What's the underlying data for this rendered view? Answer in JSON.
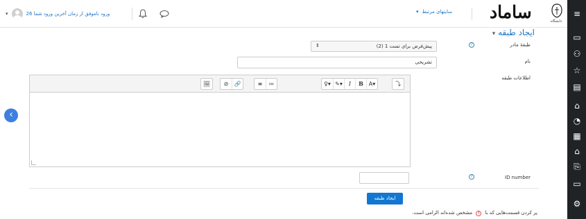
{
  "navbar": {
    "user_text": "26 ورود ناموفق از زمان آخرین ورود شما",
    "related_label": "سایتهای مرتبط",
    "logo_text": "ساماد",
    "logo_sub": "دانشگاه"
  },
  "page": {
    "section_title": "ایجاد طبقه"
  },
  "form": {
    "parent_label": "طبقهٔ مادر",
    "parent_value": "پیش‌فرض برای تست 1 (2)",
    "name_label": "نام",
    "name_value": "تشریحی",
    "info_label": "اطلاعات طبقه",
    "id_label": "ID number",
    "submit_label": "ایجاد طبقه",
    "required_note_before": "پر کردن قسمت‌هایی که با",
    "required_note_after": "مشخص شده‌اند الزامی است.",
    "help_symbol": "?",
    "required_symbol": "!"
  },
  "toolbar": {
    "groups": [
      [
        "⤵"
      ],
      [
        "A▾",
        "B",
        "I",
        "✎▾",
        "♀▾"
      ],
      [
        "≔",
        "≡"
      ],
      [
        "🔗",
        "⊘"
      ],
      [
        "🖼"
      ]
    ]
  },
  "icons": {
    "caret": "▾",
    "drawer": "‹",
    "sidebar": [
      "≡",
      "▭",
      "⚇",
      "☆",
      "▤",
      "⌂",
      "◔",
      "▦",
      "⌂",
      "⎘",
      "▭",
      "⚙"
    ]
  }
}
